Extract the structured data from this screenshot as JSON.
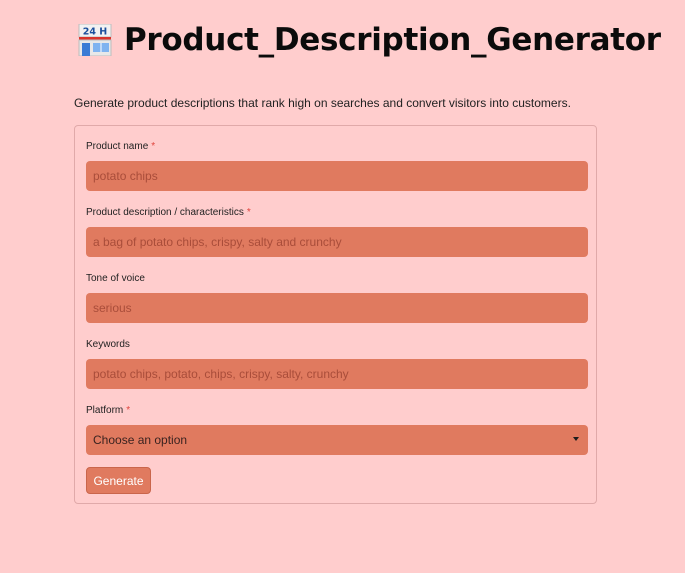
{
  "header": {
    "icon": "convenience-store-icon",
    "icon_text": "24 H",
    "title": "Product_Description_Generator"
  },
  "subtitle": "Generate product descriptions that rank high on searches and convert visitors into customers.",
  "form": {
    "product_name": {
      "label": "Product name",
      "required_mark": "*",
      "placeholder": "potato chips"
    },
    "product_description": {
      "label": "Product description / characteristics",
      "required_mark": "*",
      "placeholder": "a bag of potato chips, crispy, salty and crunchy"
    },
    "tone_of_voice": {
      "label": "Tone of voice",
      "placeholder": "serious"
    },
    "keywords": {
      "label": "Keywords",
      "placeholder": "potato chips, potato, chips, crispy, salty, crunchy"
    },
    "platform": {
      "label": "Platform",
      "required_mark": "*",
      "selected": "Choose an option"
    },
    "generate_label": "Generate"
  },
  "colors": {
    "background": "#ffcdcd",
    "input_fill": "#e07a5f",
    "required": "#e0443c",
    "placeholder": "#a94d3a"
  }
}
